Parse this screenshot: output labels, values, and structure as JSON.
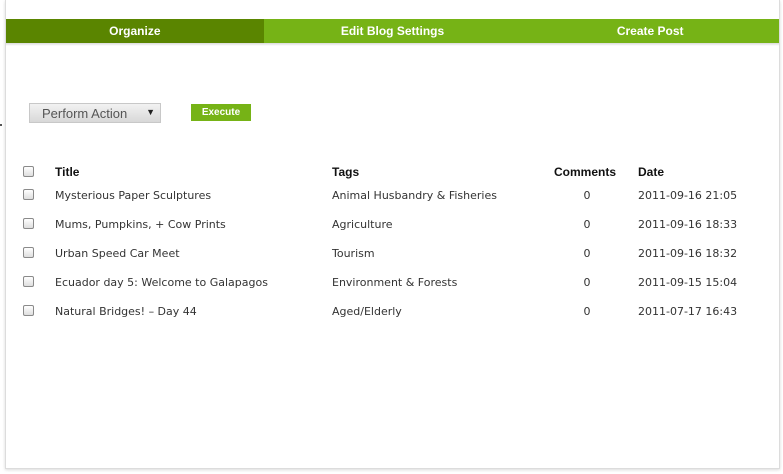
{
  "tabs": [
    {
      "label": "Organize",
      "active": true
    },
    {
      "label": "Edit Blog Settings",
      "active": false
    },
    {
      "label": "Create Post",
      "active": false
    }
  ],
  "toolbar": {
    "action_select_value": "Perform Action",
    "execute_label": "Execute"
  },
  "table": {
    "headers": {
      "title": "Title",
      "tags": "Tags",
      "comments": "Comments",
      "date": "Date"
    },
    "rows": [
      {
        "title": "Mysterious Paper Sculptures",
        "tags": "Animal Husbandry & Fisheries",
        "comments": "0",
        "date": "2011-09-16 21:05"
      },
      {
        "title": "Mums, Pumpkins, + Cow Prints",
        "tags": "Agriculture",
        "comments": "0",
        "date": "2011-09-16 18:33"
      },
      {
        "title": "Urban Speed Car Meet",
        "tags": "Tourism",
        "comments": "0",
        "date": "2011-09-16 18:32"
      },
      {
        "title": "Ecuador day 5: Welcome to Galapagos",
        "tags": "Environment & Forests",
        "comments": "0",
        "date": "2011-09-15 15:04"
      },
      {
        "title": "Natural Bridges! – Day 44",
        "tags": "Aged/Elderly",
        "comments": "0",
        "date": "2011-07-17 16:43"
      }
    ]
  },
  "colors": {
    "tab_bar": "#76b316",
    "tab_active": "#5a8500",
    "execute_button": "#76b316"
  }
}
